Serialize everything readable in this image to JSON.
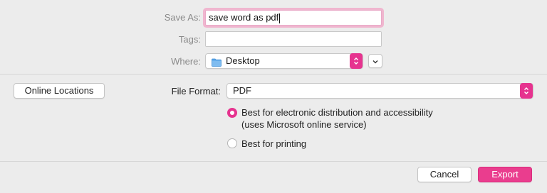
{
  "save_as": {
    "label": "Save As:",
    "value": "save word as pdf"
  },
  "tags": {
    "label": "Tags:",
    "value": ""
  },
  "where": {
    "label": "Where:",
    "value": "Desktop"
  },
  "online_locations_label": "Online Locations",
  "file_format": {
    "label": "File Format:",
    "value": "PDF"
  },
  "options": {
    "electronic_line1": "Best for electronic distribution and accessibility",
    "electronic_line2": "(uses Microsoft online service)",
    "printing": "Best for printing",
    "selected": "electronic"
  },
  "buttons": {
    "cancel": "Cancel",
    "export": "Export"
  },
  "colors": {
    "accent": "#e6338f",
    "focus_ring": "#f0b6cf",
    "folder": "#5aa6e8"
  },
  "icons": {
    "folder": "folder-icon",
    "stepper": "updown-chevron-icon",
    "expand": "chevron-down-icon"
  }
}
